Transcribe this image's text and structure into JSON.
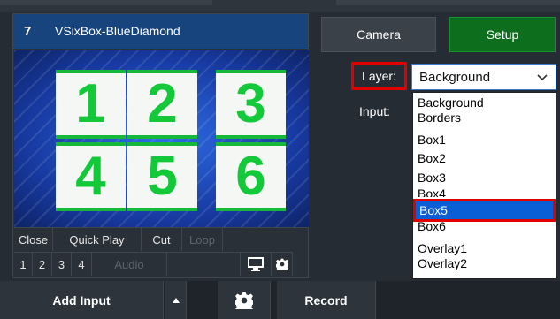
{
  "input": {
    "number": "7",
    "title": "VSixBox-BlueDiamond",
    "boxes": [
      "1",
      "2",
      "3",
      "4",
      "5",
      "6"
    ]
  },
  "controls": {
    "row1": [
      "Close",
      "Quick Play",
      "Cut",
      "Loop"
    ],
    "row2": [
      "1",
      "2",
      "3",
      "4",
      "Audio"
    ]
  },
  "tabs": {
    "camera": "Camera",
    "setup": "Setup"
  },
  "layer": {
    "label": "Layer:",
    "selected": "Background",
    "options": [
      "Background",
      "Borders",
      "Box1",
      "Box2",
      "Box3",
      "Box4",
      "Box5",
      "Box6",
      "Overlay1",
      "Overlay2"
    ],
    "highlighted": "Box5"
  },
  "input_field": {
    "label": "Input:"
  },
  "bottom": {
    "add_input": "Add Input",
    "record": "Record"
  },
  "colors": {
    "highlight": "#e00000",
    "selection": "#0a5fd6",
    "setup_tab": "#0d6f1e",
    "box_digit": "#13c93a"
  },
  "icons": [
    "chevron-down-icon",
    "monitor-icon",
    "gear-icon",
    "caret-up-icon"
  ]
}
